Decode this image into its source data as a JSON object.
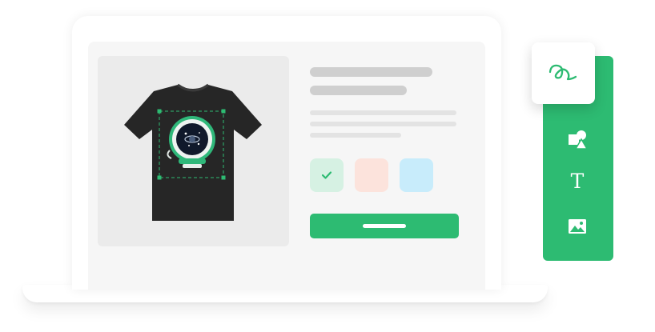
{
  "colors": {
    "accent": "#2dbb72",
    "swatch_green": "#d6f1e3",
    "swatch_peach": "#fce3dc",
    "swatch_blue": "#c8ecfb",
    "shirt": "#262626",
    "product_bg": "#ebebeb"
  },
  "product": {
    "image_icon": "astronaut-helmet-tshirt"
  },
  "color_swatches": [
    {
      "name": "green",
      "selected": true,
      "icon": "check-icon"
    },
    {
      "name": "peach",
      "selected": false
    },
    {
      "name": "blue",
      "selected": false
    }
  ],
  "tools": [
    {
      "id": "draw",
      "icon": "pen-squiggle-icon",
      "active": true
    },
    {
      "id": "shapes",
      "icon": "shapes-icon",
      "active": false
    },
    {
      "id": "text",
      "icon": "text-icon",
      "glyph": "T",
      "active": false
    },
    {
      "id": "image",
      "icon": "image-icon",
      "active": false
    }
  ]
}
